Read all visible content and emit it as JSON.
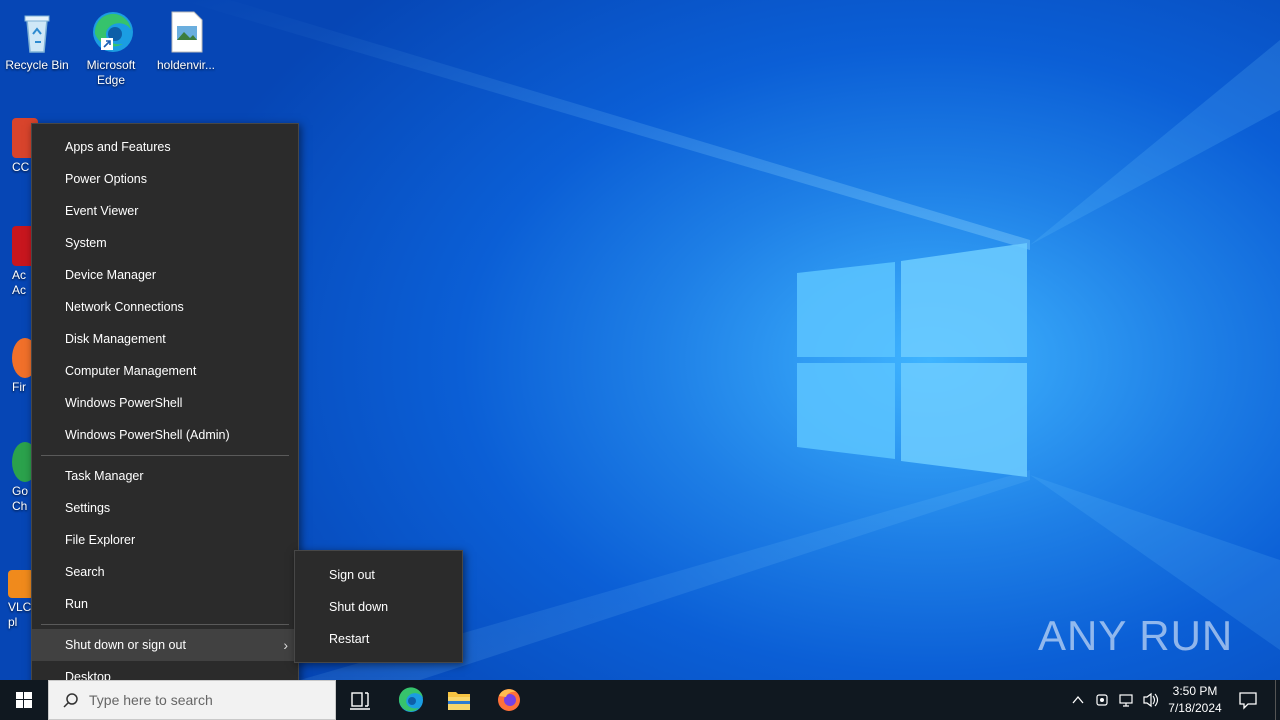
{
  "desktop": {
    "icons": [
      {
        "label": "Recycle Bin"
      },
      {
        "label": "Microsoft Edge"
      },
      {
        "label": "holdenvir..."
      }
    ],
    "partial_icons": [
      {
        "label": "CC"
      },
      {
        "label": "Ac Ac"
      },
      {
        "label": "Fir"
      },
      {
        "label": "Go Ch"
      },
      {
        "label": "VLC pl"
      }
    ]
  },
  "context_menu": {
    "group1": [
      "Apps and Features",
      "Power Options",
      "Event Viewer",
      "System",
      "Device Manager",
      "Network Connections",
      "Disk Management",
      "Computer Management",
      "Windows PowerShell",
      "Windows PowerShell (Admin)"
    ],
    "group2": [
      "Task Manager",
      "Settings",
      "File Explorer",
      "Search",
      "Run"
    ],
    "shutdown_item": "Shut down or sign out",
    "desktop_item": "Desktop"
  },
  "submenu": {
    "items": [
      "Sign out",
      "Shut down",
      "Restart"
    ]
  },
  "taskbar": {
    "search_placeholder": "Type here to search",
    "clock_time": "3:50 PM",
    "clock_date": "7/18/2024"
  },
  "watermark": "ANY RUN",
  "colors": {
    "menu_bg": "#2b2b2b",
    "menu_hover": "#414141",
    "taskbar_bg": "#101820",
    "desktop_blue": "#0b5fd6"
  }
}
